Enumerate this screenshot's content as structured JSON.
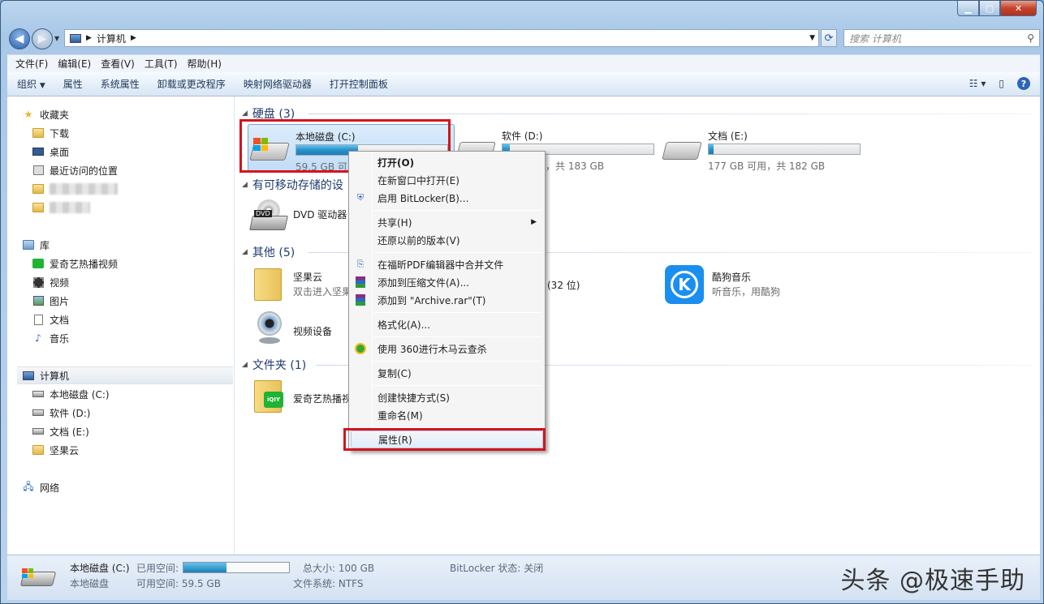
{
  "window": {
    "min_icon": "minimize-icon",
    "max_icon": "maximize-icon",
    "close_icon": "close-icon",
    "close_glyph": "✕"
  },
  "address": {
    "path_label": "计算机",
    "search_placeholder": "搜索 计算机"
  },
  "menubar": [
    "文件(F)",
    "编辑(E)",
    "查看(V)",
    "工具(T)",
    "帮助(H)"
  ],
  "toolbar": {
    "items": [
      "组织",
      "属性",
      "系统属性",
      "卸载或更改程序",
      "映射网络驱动器",
      "打开控制面板"
    ],
    "organize_arrow": "▼"
  },
  "nav": {
    "favorites": "收藏夹",
    "downloads": "下载",
    "desktop": "桌面",
    "recent": "最近访问的位置",
    "library": "库",
    "lib_items": [
      "爱奇艺热播视频",
      "视频",
      "图片",
      "文档",
      "音乐"
    ],
    "computer": "计算机",
    "computer_items": [
      "本地磁盘 (C:)",
      "软件 (D:)",
      "文档 (E:)",
      "坚果云"
    ],
    "network": "网络"
  },
  "groups": {
    "hdd": "硬盘 (3)",
    "removable": "有可移动存储的设",
    "other": "其他 (5)",
    "folders": "文件夹 (1)"
  },
  "drives": [
    {
      "name": "本地磁盘 (C:)",
      "free": "59.5 GB 可用",
      "used_fraction": 0.41
    },
    {
      "name": "软件 (D:)",
      "free": "用，共 183 GB",
      "used_fraction": 0.05
    },
    {
      "name": "文档 (E:)",
      "free": "177 GB 可用，共 182 GB",
      "used_fraction": 0.03
    }
  ],
  "dvd": {
    "name": "DVD 驱动器",
    "label": "DVD"
  },
  "other_items": [
    {
      "name": "坚果云",
      "sub": "双击进入坚果"
    },
    {
      "name": "视频设备",
      "sub": ""
    },
    {
      "name": "(32 位)",
      "sub": ""
    },
    {
      "name": "酷狗音乐",
      "sub": "听音乐，用酷狗",
      "icon_letter": "K"
    }
  ],
  "folder_items": [
    {
      "name": "爱奇艺热播视",
      "icon_text": "iQIY"
    }
  ],
  "context_menu": {
    "open": "打开(O)",
    "open_new": "在新窗口中打开(E)",
    "bitlocker": "启用 BitLocker(B)...",
    "share": "共享(H)",
    "restore": "还原以前的版本(V)",
    "pdf_merge": "在福昕PDF编辑器中合并文件",
    "add_archive": "添加到压缩文件(A)...",
    "add_rar": "添加到 \"Archive.rar\"(T)",
    "format": "格式化(A)...",
    "scan360": "使用 360进行木马云查杀",
    "copy": "复制(C)",
    "shortcut": "创建快捷方式(S)",
    "rename": "重命名(M)",
    "properties": "属性(R)"
  },
  "status": {
    "name": "本地磁盘 (C:)",
    "type": "本地磁盘",
    "used_label": "已用空间:",
    "free_label": "可用空间: 59.5 GB",
    "total": "总大小: 100 GB",
    "fs": "文件系统: NTFS",
    "bitlocker": "BitLocker 状态: 关闭",
    "used_fraction": 0.41
  },
  "watermark": "头条 @极速手助",
  "accent": "#d4141c"
}
